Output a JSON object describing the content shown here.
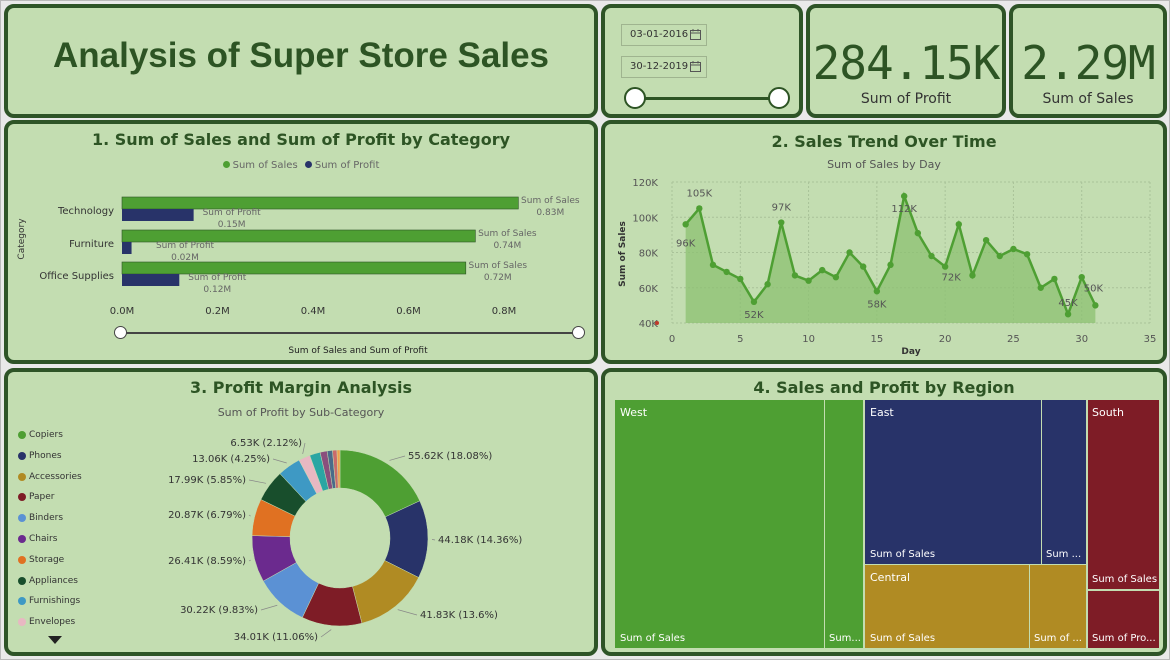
{
  "dashboard": {
    "title": "Analysis of Super Store Sales"
  },
  "date_filter": {
    "start": "03-01-2016",
    "end": "30-12-2019"
  },
  "kpis": [
    {
      "value": "284.15K",
      "label": "Sum of Profit"
    },
    {
      "value": "2.29M",
      "label": "Sum of Sales"
    }
  ],
  "colors": {
    "sales": "#4e9f33",
    "profit": "#283369",
    "card_bg": "#c3ddb1",
    "border": "#2e5427"
  },
  "panel1": {
    "title": "1. Sum of Sales and Sum of Profit by Category",
    "legend": [
      "Sum of Sales",
      "Sum of Profit"
    ],
    "y_axis_title": "Category",
    "x_axis_title": "Sum of Sales and Sum of Profit"
  },
  "panel2": {
    "title": "2. Sales Trend Over Time",
    "subtitle": "Sum of Sales by Day",
    "y_axis_title": "Sum of Sales",
    "x_axis_title": "Day"
  },
  "panel3": {
    "title": "3. Profit Margin Analysis",
    "subtitle": "Sum of Profit by Sub-Category",
    "legend": [
      "Copiers",
      "Phones",
      "Accessories",
      "Paper",
      "Binders",
      "Chairs",
      "Storage",
      "Appliances",
      "Furnishings",
      "Envelopes"
    ]
  },
  "panel4": {
    "title": "4. Sales and Profit by Region",
    "regions": {
      "west": "West",
      "east": "East",
      "central": "Central",
      "south": "South"
    },
    "cell_labels": {
      "west_sales": "Sum of Sales",
      "west_small": "Sum...",
      "east_sales": "Sum of Sales",
      "east_small": "Sum ...",
      "central_sales": "Sum of Sales",
      "central_small": "Sum of ...",
      "south_sales": "Sum of Sales",
      "south_profit": "Sum of Pro..."
    }
  },
  "chart_data": [
    {
      "type": "bar",
      "orientation": "horizontal",
      "title": "1. Sum of Sales and Sum of Profit by Category",
      "categories": [
        "Technology",
        "Furniture",
        "Office Supplies"
      ],
      "series": [
        {
          "name": "Sum of Sales",
          "values": [
            0.83,
            0.74,
            0.72
          ],
          "labels": [
            "0.83M",
            "0.74M",
            "0.72M"
          ]
        },
        {
          "name": "Sum of Profit",
          "values": [
            0.15,
            0.02,
            0.12
          ],
          "labels": [
            "0.15M",
            "0.02M",
            "0.12M"
          ]
        }
      ],
      "xlim": [
        0,
        0.9
      ],
      "xticks": [
        "0.0M",
        "0.2M",
        "0.4M",
        "0.6M",
        "0.8M"
      ],
      "xlabel": "Sum of Sales and Sum of Profit",
      "ylabel": "Category",
      "legend": "top-center"
    },
    {
      "type": "area",
      "title": "2. Sales Trend Over Time",
      "subtitle": "Sum of Sales by Day",
      "x": [
        1,
        2,
        3,
        4,
        5,
        6,
        7,
        8,
        9,
        10,
        11,
        12,
        13,
        14,
        15,
        16,
        17,
        18,
        19,
        20,
        21,
        22,
        23,
        24,
        25,
        26,
        27,
        28,
        29,
        30,
        31
      ],
      "y": [
        96,
        105,
        73,
        69,
        65,
        52,
        62,
        97,
        67,
        64,
        70,
        66,
        80,
        72,
        58,
        73,
        112,
        91,
        78,
        72,
        96,
        67,
        87,
        78,
        82,
        79,
        60,
        65,
        45,
        66,
        50
      ],
      "unit": "K",
      "point_labels": [
        {
          "x": 1,
          "label": "96K"
        },
        {
          "x": 2,
          "label": "105K"
        },
        {
          "x": 6,
          "label": "52K"
        },
        {
          "x": 8,
          "label": "97K"
        },
        {
          "x": 15,
          "label": "58K"
        },
        {
          "x": 17,
          "label": "112K"
        },
        {
          "x": 20,
          "label": "72K"
        },
        {
          "x": 29,
          "label": "45K"
        },
        {
          "x": 31,
          "label": "50K"
        }
      ],
      "xlim": [
        0,
        35
      ],
      "ylim": [
        40,
        120
      ],
      "xticks": [
        0,
        5,
        10,
        15,
        20,
        25,
        30,
        35
      ],
      "yticks": [
        "40K",
        "60K",
        "80K",
        "100K",
        "120K"
      ],
      "xlabel": "Day",
      "ylabel": "Sum of Sales",
      "grid": true
    },
    {
      "type": "pie",
      "variant": "donut",
      "title": "3. Profit Margin Analysis",
      "subtitle": "Sum of Profit by Sub-Category",
      "slices": [
        {
          "name": "Copiers",
          "value": 55.62,
          "label": "55.62K (18.08%)",
          "color": "#4e9f33"
        },
        {
          "name": "Phones",
          "value": 44.18,
          "label": "44.18K (14.36%)",
          "color": "#283369"
        },
        {
          "name": "Accessories",
          "value": 41.83,
          "label": "41.83K (13.6%)",
          "color": "#b08b23"
        },
        {
          "name": "Paper",
          "value": 34.01,
          "label": "34.01K (11.06%)",
          "color": "#7e1c26"
        },
        {
          "name": "Binders",
          "value": 30.22,
          "label": "30.22K (9.83%)",
          "color": "#5b91d4"
        },
        {
          "name": "Chairs",
          "value": 26.41,
          "label": "26.41K (8.59%)",
          "color": "#6b2a8e"
        },
        {
          "name": "Storage",
          "value": 20.87,
          "label": "20.87K (6.79%)",
          "color": "#e07122"
        },
        {
          "name": "Appliances",
          "value": 17.99,
          "label": "17.99K (5.85%)",
          "color": "#184e2c"
        },
        {
          "name": "Furnishings",
          "value": 13.06,
          "label": "13.06K (4.25%)",
          "color": "#3e99c4"
        },
        {
          "name": "Envelopes",
          "value": 6.53,
          "label": "6.53K (2.12%)",
          "color": "#e8b8c2"
        },
        {
          "name": "",
          "value": 6.0,
          "label": "",
          "color": "#2aa6a3"
        },
        {
          "name": "",
          "value": 4.0,
          "label": "",
          "color": "#8a4f7d"
        },
        {
          "name": "",
          "value": 3.0,
          "label": "",
          "color": "#4a6b8a"
        },
        {
          "name": "",
          "value": 2.5,
          "label": "",
          "color": "#c96b6b"
        },
        {
          "name": "",
          "value": 1.7,
          "label": "",
          "color": "#f0a04b"
        }
      ]
    },
    {
      "type": "treemap",
      "title": "4. Sales and Profit by Region",
      "regions": [
        {
          "name": "West",
          "sales": 725,
          "profit": 108,
          "color": "#4e9f33"
        },
        {
          "name": "East",
          "sales": 679,
          "profit": 92,
          "color": "#283369"
        },
        {
          "name": "Central",
          "sales": 501,
          "profit": 40,
          "color": "#b08b23"
        },
        {
          "name": "South",
          "sales": 392,
          "profit": 47,
          "color": "#7e1c26"
        }
      ]
    }
  ]
}
